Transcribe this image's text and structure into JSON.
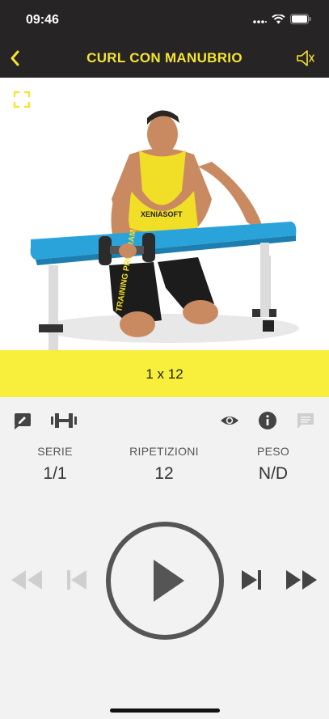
{
  "status_bar": {
    "time": "09:46"
  },
  "navbar": {
    "title": "CURL CON MANUBRIO",
    "accent": "#f5e431",
    "background": "#262424"
  },
  "media": {
    "banner_text": "1 x 12",
    "shirt_text": "XENIASOFT",
    "shorts_text": "TRAINING PROGRAM",
    "banner_color": "#f7ef3b"
  },
  "toolbar": {
    "left_icons": [
      "edit-note-icon",
      "dumbbell-icon"
    ],
    "right_icons": [
      "eye-icon",
      "info-icon",
      "comment-icon"
    ]
  },
  "stats": [
    {
      "label": "SERIE",
      "value": "1/1"
    },
    {
      "label": "RIPETIZIONI",
      "value": "12"
    },
    {
      "label": "PESO",
      "value": "N/D"
    }
  ],
  "controls": {
    "icons": [
      "rewind-icon",
      "skip-previous-icon",
      "play-icon",
      "skip-next-icon",
      "fast-forward-icon"
    ]
  }
}
